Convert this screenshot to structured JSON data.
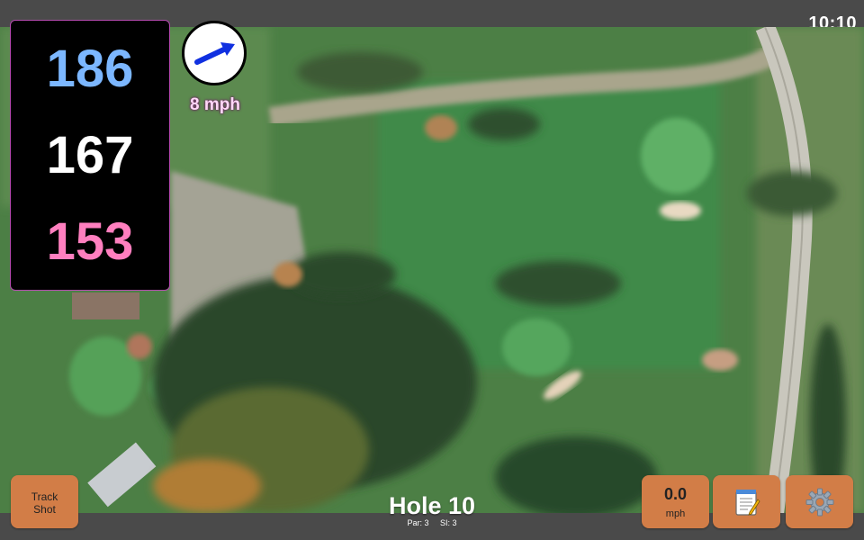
{
  "status_bar": {
    "clock": "10:10"
  },
  "distances": {
    "back": "186",
    "middle": "167",
    "front": "153"
  },
  "wind": {
    "speed": "8 mph",
    "direction_icon": "arrow-up-right-icon"
  },
  "hole": {
    "title": "Hole 10",
    "par": "Par: 3",
    "si": "SI: 3"
  },
  "buttons": {
    "track_shot_line1": "Track",
    "track_shot_line2": "Shot",
    "speed_value": "0.0",
    "speed_unit": "mph",
    "notes_icon": "notepad-icon",
    "settings_icon": "gear-icon"
  },
  "colors": {
    "back_distance": "#7cb7ff",
    "middle_distance": "#ffffff",
    "front_distance": "#ff7fbf",
    "button": "#d27d47",
    "wind_arrow": "#1030e0"
  }
}
